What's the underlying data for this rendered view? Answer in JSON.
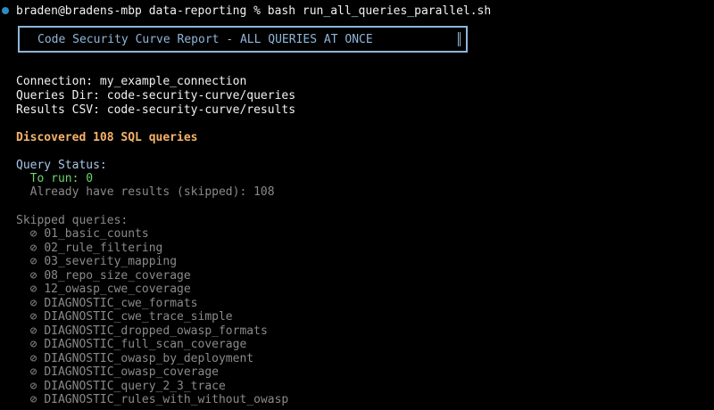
{
  "prompt": {
    "text": "braden@bradens-mbp data-reporting % bash run_all_queries_parallel.sh"
  },
  "banner": {
    "title": "Code Security Curve Report - ALL QUERIES AT ONCE"
  },
  "info": {
    "connection": "Connection: my_example_connection",
    "queries_dir": "Queries Dir: code-security-curve/queries",
    "results_csv": "Results CSV: code-security-curve/results"
  },
  "discovered": "Discovered 108 SQL queries",
  "status": {
    "header": "Query Status:",
    "to_run": "  To run: 0",
    "skipped": "  Already have results (skipped): 108"
  },
  "skipped_section": {
    "header": "Skipped queries:",
    "icon": "⊘",
    "items": [
      "01_basic_counts",
      "02_rule_filtering",
      "03_severity_mapping",
      "08_repo_size_coverage",
      "12_owasp_cwe_coverage",
      "DIAGNOSTIC_cwe_formats",
      "DIAGNOSTIC_cwe_trace_simple",
      "DIAGNOSTIC_dropped_owasp_formats",
      "DIAGNOSTIC_full_scan_coverage",
      "DIAGNOSTIC_owasp_by_deployment",
      "DIAGNOSTIC_owasp_coverage",
      "DIAGNOSTIC_query_2_3_trace",
      "DIAGNOSTIC_rules_with_without_owasp"
    ]
  },
  "colors": {
    "background": "#000000",
    "prompt_dot": "#2e8bc4",
    "banner": "#8fb6d9",
    "heading_blue": "#a9c6e8",
    "green": "#6fd56f",
    "gray": "#8a8a8a",
    "orange": "#f6b26b"
  }
}
